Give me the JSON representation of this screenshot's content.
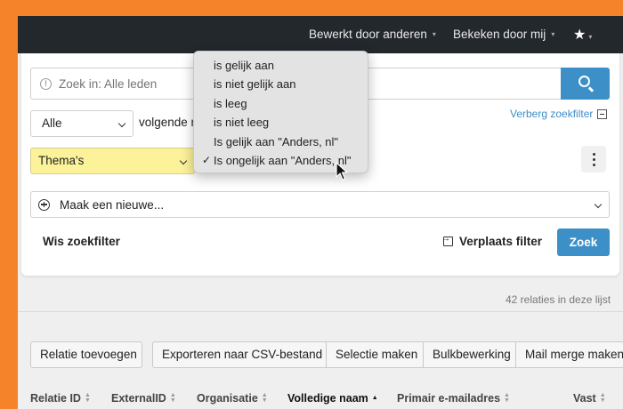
{
  "topbar": {
    "nav": [
      "Bewerkt door anderen",
      "Bekeken door mij"
    ],
    "favorites_icon": "star-icon"
  },
  "search": {
    "placeholder": "Zoek in: Alle leden",
    "button_icon": "search-icon"
  },
  "filter": {
    "scope_value": "Alle",
    "scope_suffix": "volgende r",
    "hide_link": "Verberg zoekfilter",
    "field_value": "Thema's",
    "new_placeholder": "Maak een nieuwe...",
    "clear_label": "Wis zoekfilter",
    "move_label": "Verplaats filter",
    "submit_label": "Zoek"
  },
  "operator_dropdown": {
    "options": [
      "is gelijk aan",
      "is niet gelijk aan",
      "is leeg",
      "is niet leeg",
      "Is gelijk aan \"Anders, nl\"",
      "Is ongelijk aan \"Anders, nl\""
    ],
    "selected_index": 5,
    "check_mark": "✓"
  },
  "results": {
    "count_text": "42 relaties in deze lijst"
  },
  "actions": [
    "Relatie toevoegen",
    "Exporteren naar CSV-bestand",
    "Selectie maken",
    "Bulkbewerking",
    "Mail merge maken"
  ],
  "table": {
    "columns": [
      "Relatie ID",
      "ExternalID",
      "Organisatie",
      "Volledige naam",
      "Primair e-mailadres",
      "Vast"
    ],
    "sorted_column": "Volledige naam",
    "sort_direction": "ascending"
  },
  "colors": {
    "frame": "#f5832a",
    "topbar": "#23282d",
    "accent": "#3d8fc7",
    "highlight_field": "#fbf29a"
  }
}
